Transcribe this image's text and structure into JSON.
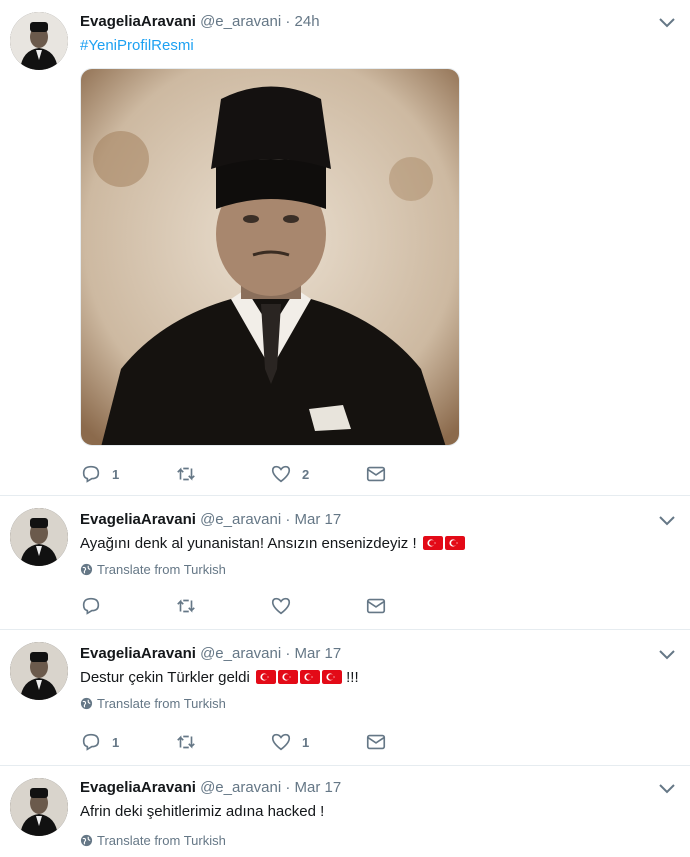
{
  "author": {
    "name": "EvageliaAravani",
    "handle": "@e_aravani"
  },
  "dot": "·",
  "tweets": [
    {
      "time": "24h",
      "text": "#YeniProfilResmi",
      "translate": "",
      "reply_count": "1",
      "retweet_count": "",
      "like_count": "2",
      "has_media": true
    },
    {
      "time": "Mar 17",
      "text": "Ayağını denk al yunanistan! Ansızın ensenizdeyiz !",
      "flags": 2,
      "translate": "Translate from Turkish",
      "reply_count": "",
      "retweet_count": "",
      "like_count": ""
    },
    {
      "time": "Mar 17",
      "text": "Destur çekin Türkler geldi",
      "flags": 4,
      "text_suffix": "!!!",
      "translate": "Translate from Turkish",
      "reply_count": "1",
      "retweet_count": "",
      "like_count": "1"
    },
    {
      "time": "Mar 17",
      "text": "Afrin deki şehitlerimiz adına hacked !",
      "translate": "Translate from Turkish"
    }
  ],
  "icons": {
    "reply": "reply-icon",
    "retweet": "retweet-icon",
    "like": "heart-icon",
    "dm": "envelope-icon",
    "menu": "chevron-down-icon",
    "globe": "globe-icon"
  },
  "colors": {
    "text": "#14171a",
    "secondary": "#657786",
    "link": "#1da1f2",
    "flag_red": "#e30a17",
    "divider": "#e6ecf0"
  }
}
